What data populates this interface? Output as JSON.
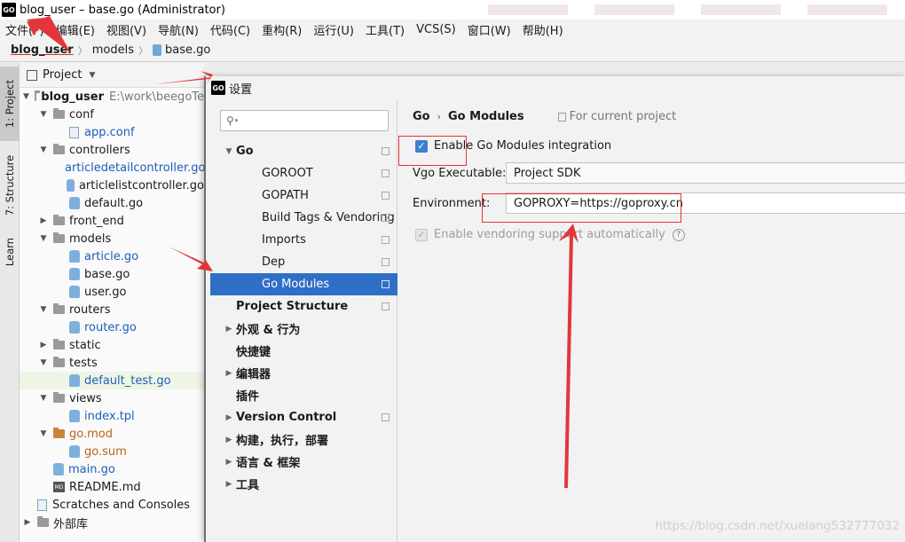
{
  "window": {
    "title": "blog_user – base.go (Administrator)",
    "app_icon": "GO"
  },
  "menu": [
    "文件(F)",
    "编辑(E)",
    "视图(V)",
    "导航(N)",
    "代码(C)",
    "重构(R)",
    "运行(U)",
    "工具(T)",
    "VCS(S)",
    "窗口(W)",
    "帮助(H)"
  ],
  "breadcrumb": [
    "blog_user",
    "models",
    "base.go"
  ],
  "toolstrip": [
    "1: Project",
    "7: Structure",
    "Learn"
  ],
  "project_panel": {
    "title": "Project",
    "root_name": "blog_user",
    "root_path": "E:\\work\\beegoTe",
    "tree": [
      {
        "label": "conf",
        "kind": "folder",
        "depth": 1,
        "open": true
      },
      {
        "label": "app.conf",
        "kind": "conf",
        "depth": 2,
        "link": true
      },
      {
        "label": "controllers",
        "kind": "folder",
        "depth": 1,
        "open": true
      },
      {
        "label": "articledetailcontroller.go",
        "kind": "go",
        "depth": 2,
        "link": true
      },
      {
        "label": "articlelistcontroller.go",
        "kind": "go",
        "depth": 2
      },
      {
        "label": "default.go",
        "kind": "go",
        "depth": 2
      },
      {
        "label": "front_end",
        "kind": "folder",
        "depth": 1,
        "open": false
      },
      {
        "label": "models",
        "kind": "folder",
        "depth": 1,
        "open": true
      },
      {
        "label": "article.go",
        "kind": "go",
        "depth": 2,
        "link": true
      },
      {
        "label": "base.go",
        "kind": "go",
        "depth": 2
      },
      {
        "label": "user.go",
        "kind": "go",
        "depth": 2
      },
      {
        "label": "routers",
        "kind": "folder",
        "depth": 1,
        "open": true
      },
      {
        "label": "router.go",
        "kind": "go",
        "depth": 2,
        "link": true
      },
      {
        "label": "static",
        "kind": "folder",
        "depth": 1,
        "open": false
      },
      {
        "label": "tests",
        "kind": "folder",
        "depth": 1,
        "open": true
      },
      {
        "label": "default_test.go",
        "kind": "go",
        "depth": 2,
        "link": true,
        "selected": true
      },
      {
        "label": "views",
        "kind": "folder",
        "depth": 1,
        "open": true
      },
      {
        "label": "index.tpl",
        "kind": "go",
        "depth": 2,
        "link": true
      },
      {
        "label": "go.mod",
        "kind": "modfolder",
        "depth": 1,
        "open": true,
        "mod": true
      },
      {
        "label": "go.sum",
        "kind": "go",
        "depth": 2,
        "mod": true
      },
      {
        "label": "main.go",
        "kind": "go",
        "depth": 1,
        "link": true
      },
      {
        "label": "README.md",
        "kind": "md",
        "depth": 1
      },
      {
        "label": "Scratches and Consoles",
        "kind": "scratch",
        "depth": 0
      },
      {
        "label": "外部库",
        "kind": "lib",
        "depth": 0
      }
    ]
  },
  "dialog": {
    "title": "设置",
    "search_placeholder": "",
    "nav": [
      {
        "label": "Go",
        "bold": true,
        "toggle": "▼",
        "indent": 0,
        "copy": true
      },
      {
        "label": "GOROOT",
        "indent": 2,
        "copy": true
      },
      {
        "label": "GOPATH",
        "indent": 2,
        "copy": true
      },
      {
        "label": "Build Tags & Vendoring",
        "indent": 2,
        "copy": true
      },
      {
        "label": "Imports",
        "indent": 2,
        "copy": true
      },
      {
        "label": "Dep",
        "indent": 2,
        "copy": true
      },
      {
        "label": "Go Modules",
        "indent": 2,
        "copy": true,
        "selected": true
      },
      {
        "label": "Project Structure",
        "bold": true,
        "indent": 1,
        "copy": true
      },
      {
        "label": "外观 & 行为",
        "bold": true,
        "toggle": "▶",
        "indent": 0
      },
      {
        "label": "快捷键",
        "bold": true,
        "indent": 1
      },
      {
        "label": "编辑器",
        "bold": true,
        "toggle": "▶",
        "indent": 0
      },
      {
        "label": "插件",
        "bold": true,
        "indent": 1
      },
      {
        "label": "Version Control",
        "bold": true,
        "toggle": "▶",
        "indent": 0,
        "copy": true
      },
      {
        "label": "构建，执行，部署",
        "bold": true,
        "toggle": "▶",
        "indent": 0
      },
      {
        "label": "语言 & 框架",
        "bold": true,
        "toggle": "▶",
        "indent": 0
      },
      {
        "label": "工具",
        "bold": true,
        "toggle": "▶",
        "indent": 0
      }
    ],
    "content": {
      "crumb_parent": "Go",
      "crumb_current": "Go Modules",
      "scope": "For current project",
      "enable_label": "Enable Go Modules integration",
      "enable_checked": true,
      "vgo_label": "Vgo Executable:",
      "vgo_value": "Project SDK",
      "env_label": "Environment:",
      "env_value": "GOPROXY=https://goproxy.cn",
      "vendoring_label": "Enable vendoring support automatically",
      "vendoring_checked": true
    }
  },
  "watermark": "https://blog.csdn.net/xuelang532777032",
  "colors": {
    "selection": "#2f6fc6",
    "checkbox": "#3d7fd1",
    "annotation": "#e3353b",
    "link": "#1e5dbb"
  }
}
